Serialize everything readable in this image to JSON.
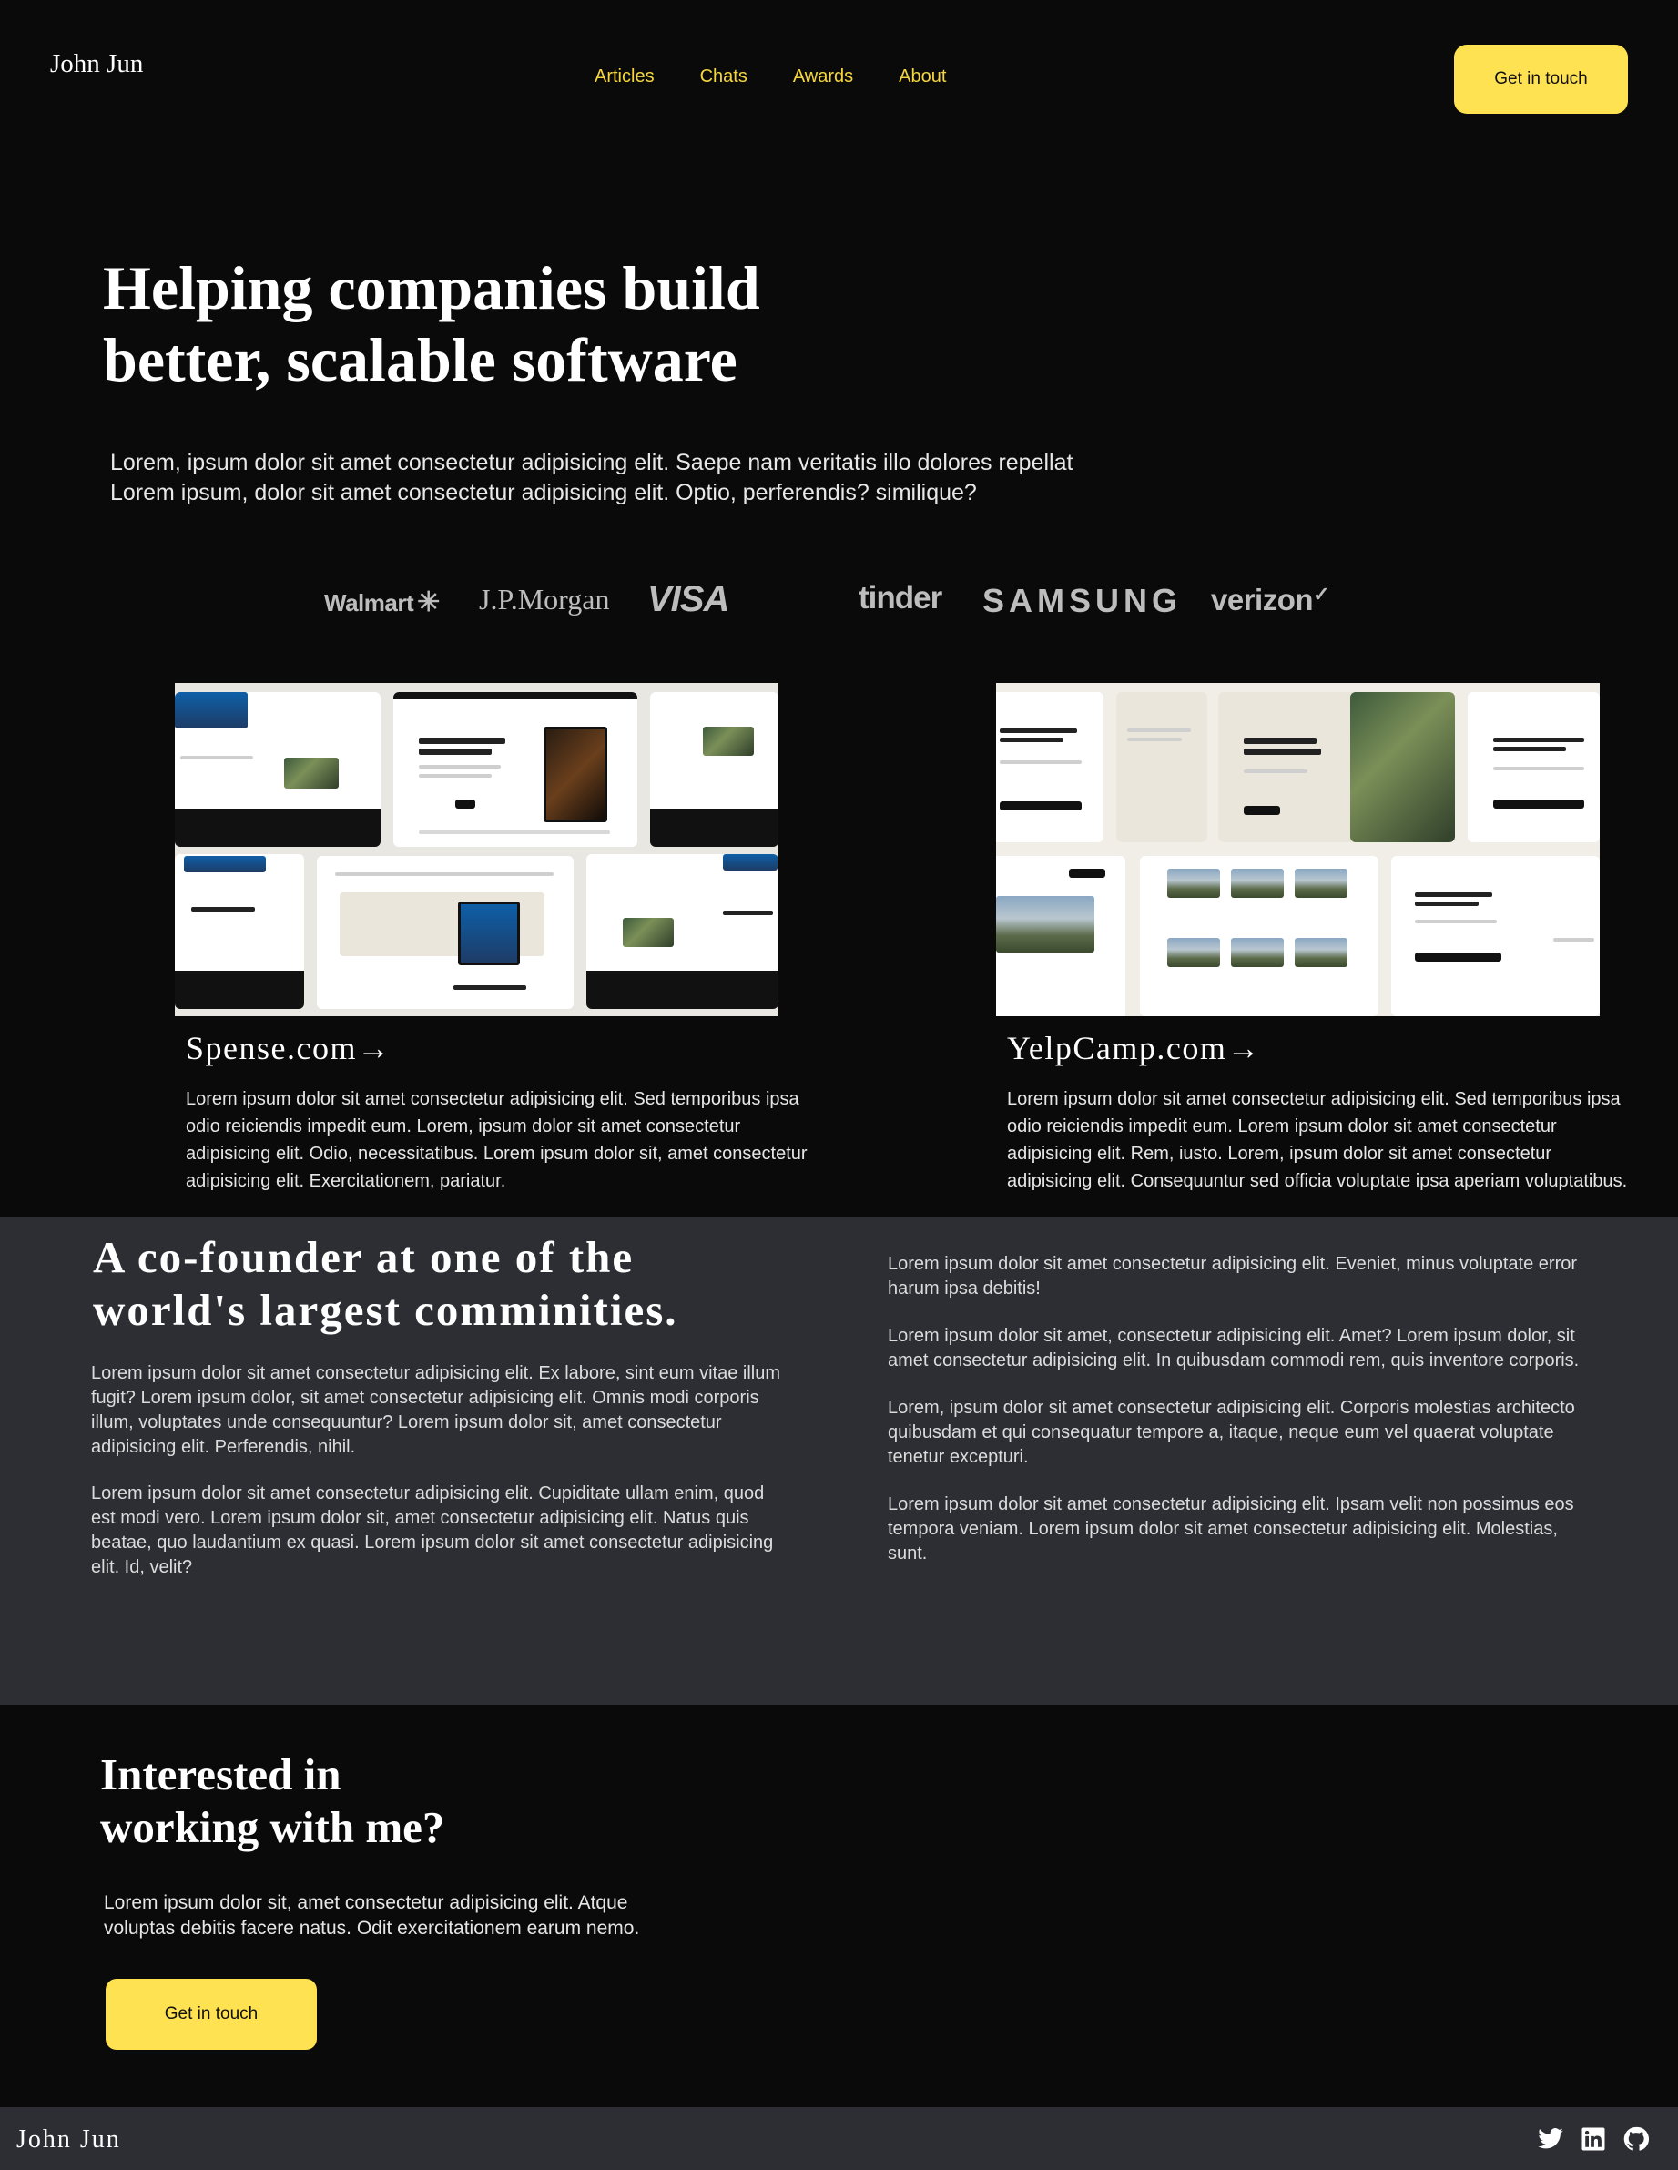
{
  "nav": {
    "brand": "John Jun",
    "links": [
      "Articles",
      "Chats",
      "Awards",
      "About"
    ],
    "cta": "Get in touch"
  },
  "hero": {
    "title_line1": "Helping companies build",
    "title_line2": "better, scalable software",
    "subtitle_line1": "Lorem, ipsum dolor sit amet consectetur adipisicing elit. Saepe nam veritatis illo dolores repellat",
    "subtitle_line2": "Lorem ipsum, dolor sit amet consectetur adipisicing elit. Optio, perferendis? similique?"
  },
  "clients": [
    "Walmart",
    "J.P.Morgan",
    "VISA",
    "tinder",
    "SAMSUNG",
    "verizon"
  ],
  "projects": [
    {
      "title": "Spense.com",
      "arrow": "→",
      "description": "Lorem ipsum dolor sit amet consectetur adipisicing elit. Sed temporibus ipsa odio reiciendis impedit eum. Lorem, ipsum dolor sit amet consectetur adipisicing elit. Odio, necessitatibus. Lorem ipsum dolor sit, amet consectetur adipisicing elit. Exercitationem, pariatur."
    },
    {
      "title": "YelpCamp.com",
      "arrow": "→",
      "description": "Lorem ipsum dolor sit amet consectetur adipisicing elit. Sed temporibus ipsa odio reiciendis impedit eum. Lorem ipsum dolor sit amet consectetur adipisicing elit. Rem, iusto. Lorem, ipsum dolor sit amet consectetur adipisicing elit. Consequuntur sed officia voluptate ipsa aperiam voluptatibus."
    }
  ],
  "about": {
    "title_line1": "A co-founder at one of the",
    "title_line2": "world's largest comminities.",
    "left": [
      "Lorem ipsum dolor sit amet consectetur adipisicing elit. Ex labore, sint eum vitae illum fugit? Lorem ipsum dolor, sit amet consectetur adipisicing elit. Omnis modi corporis illum, voluptates unde consequuntur? Lorem ipsum dolor sit, amet consectetur adipisicing elit. Perferendis, nihil.",
      "Lorem ipsum dolor sit amet consectetur adipisicing elit. Cupiditate ullam enim, quod est modi vero. Lorem ipsum dolor sit, amet consectetur adipisicing elit. Natus quis beatae, quo laudantium ex quasi. Lorem ipsum dolor sit amet consectetur adipisicing elit. Id, velit?"
    ],
    "right": [
      "Lorem ipsum dolor sit amet consectetur adipisicing elit. Eveniet, minus voluptate error harum ipsa debitis!",
      "Lorem ipsum dolor sit amet, consectetur adipisicing elit. Amet? Lorem ipsum dolor, sit amet consectetur adipisicing elit. In quibusdam commodi rem, quis inventore corporis.",
      "Lorem, ipsum dolor sit amet consectetur adipisicing elit. Corporis molestias architecto quibusdam et qui consequatur tempore a, itaque, neque eum vel quaerat voluptate tenetur excepturi.",
      "Lorem ipsum dolor sit amet consectetur adipisicing elit. Ipsam velit non possimus eos tempora veniam. Lorem ipsum dolor sit amet consectetur adipisicing elit. Molestias, sunt."
    ]
  },
  "contact": {
    "title_line1": "Interested in",
    "title_line2": "working with me?",
    "text": "Lorem ipsum dolor sit, amet consectetur adipisicing elit. Atque voluptas debitis facere natus. Odit exercitationem earum nemo.",
    "cta": "Get in touch"
  },
  "footer": {
    "brand": "John Jun",
    "social_icons": [
      "twitter-icon",
      "linkedin-icon",
      "github-icon"
    ]
  },
  "colors": {
    "background": "#0a0a0a",
    "accent": "#ffe251",
    "nav_link": "#f5d63e",
    "section": "#2c2e33"
  }
}
